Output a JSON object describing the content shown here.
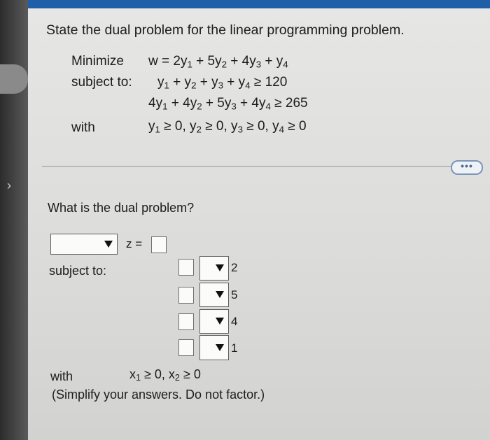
{
  "header": {
    "question": "State the dual problem for the linear programming problem."
  },
  "primal": {
    "minimize_label": "Minimize",
    "objective": {
      "lhs": "w = 2y",
      "t2": " + 5y",
      "t3": " + 4y",
      "t4": " + y"
    },
    "subject_to_label": "subject to:",
    "c1": {
      "a": "y",
      "b": " +  y",
      "c": " +  y",
      "d": " +  y",
      "rhs": " ≥ 120"
    },
    "c2": {
      "a": "4y",
      "b": " + 4y",
      "c": " + 5y",
      "d": " + 4y",
      "rhs": " ≥ 265"
    },
    "with_label": "with",
    "nonneg": {
      "a": "y",
      "b": " ≥ 0, y",
      "c": " ≥ 0, y",
      "d": " ≥ 0, y",
      "e": " ≥ 0"
    },
    "subs": [
      "1",
      "2",
      "3",
      "4"
    ]
  },
  "more_button_label": "•••",
  "dual": {
    "prompt": "What is the dual problem?",
    "objective_eq": "z =",
    "subject_to_label": "subject to:",
    "constraint_rhs": [
      "2",
      "5",
      "4",
      "1"
    ],
    "with_label": "with",
    "nonneg": {
      "a": "x",
      "b": " ≥ 0, x",
      "c": " ≥ 0"
    },
    "nonneg_subs": [
      "1",
      "2"
    ],
    "note": "(Simplify your answers. Do not factor.)"
  }
}
